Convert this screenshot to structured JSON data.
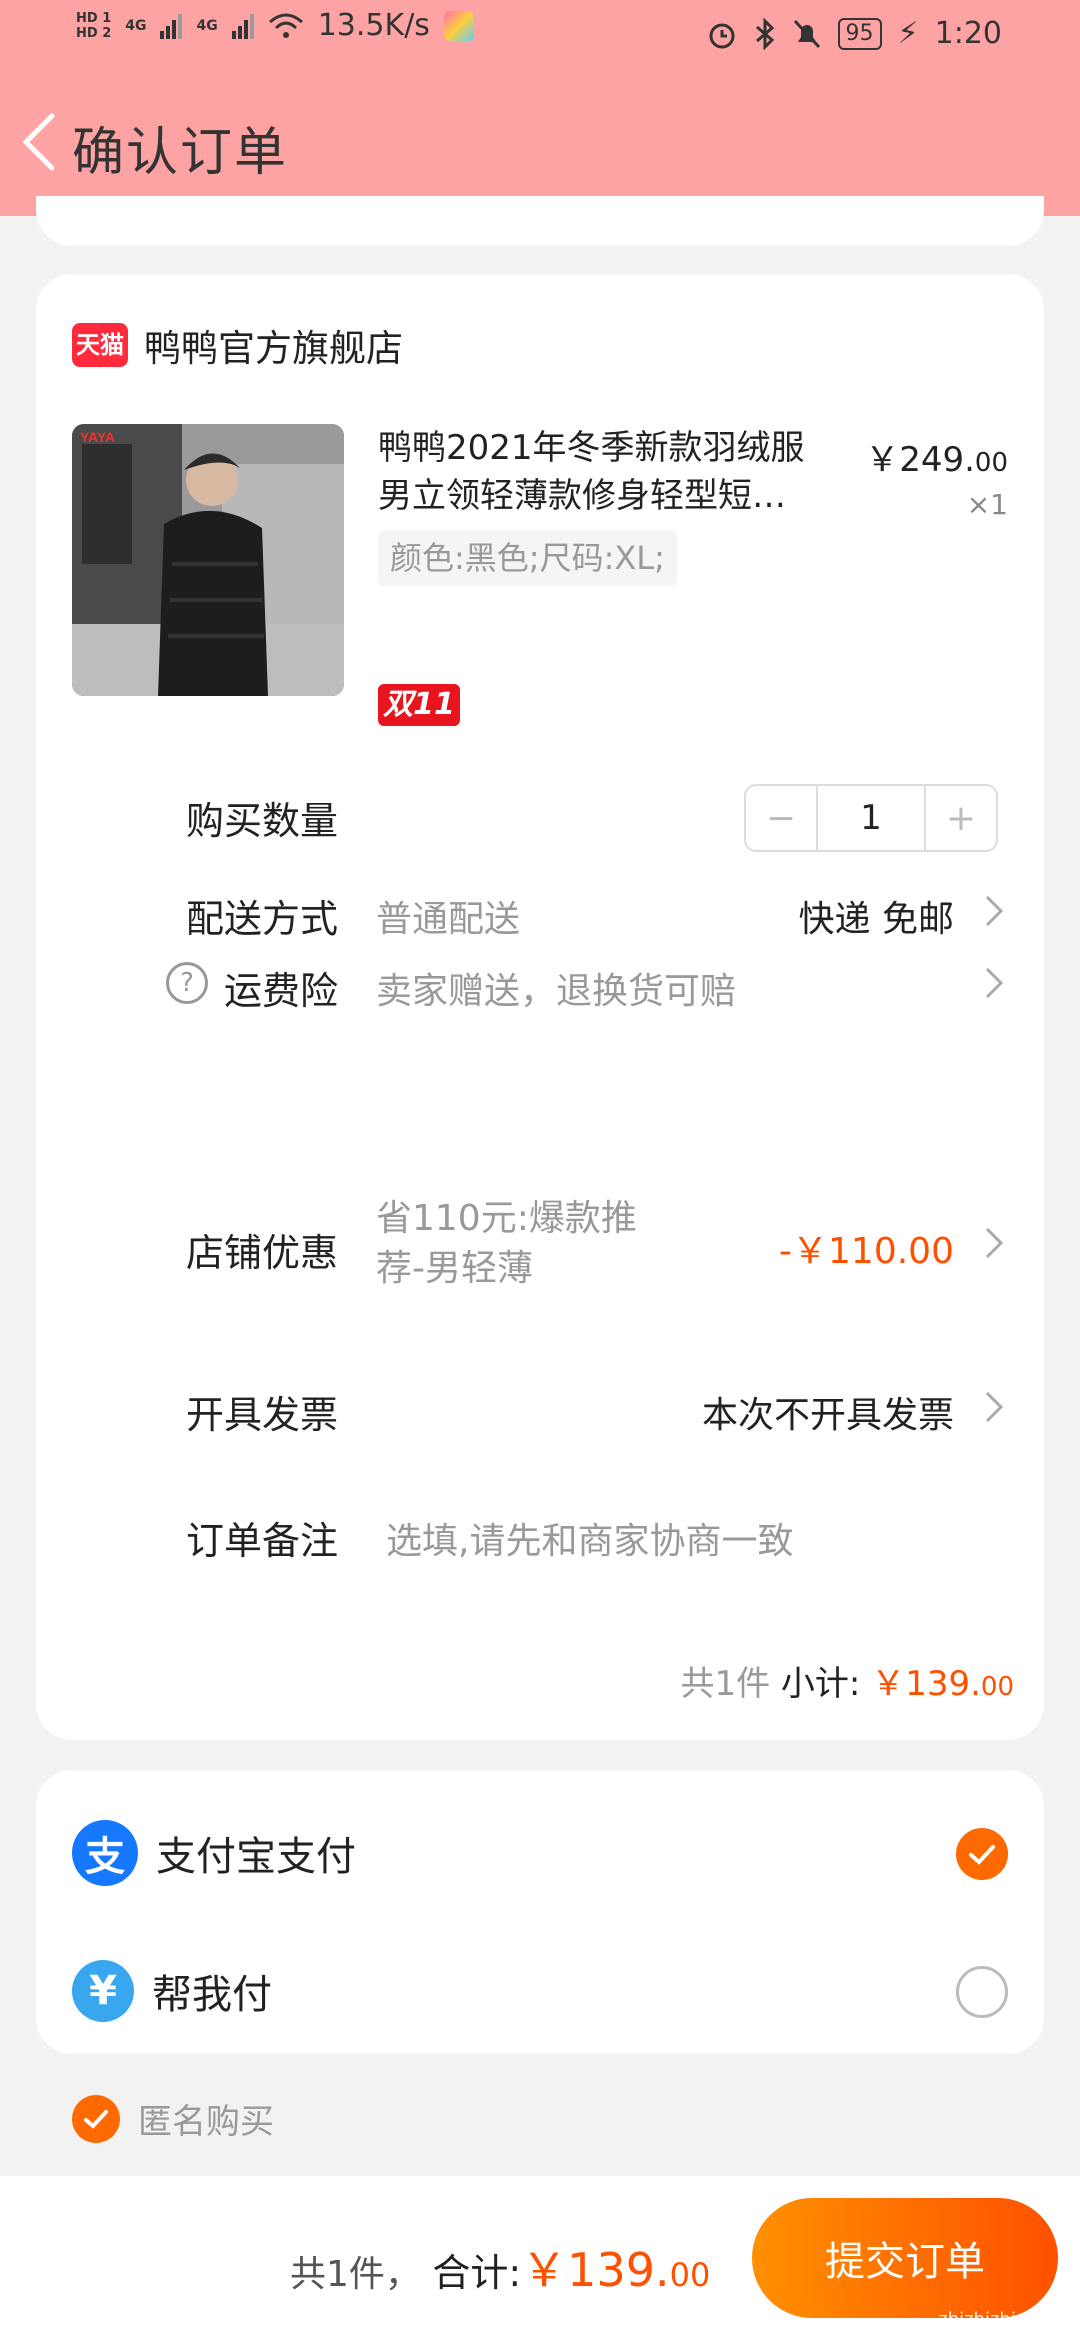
{
  "status_bar": {
    "net_speed": "13.5K/s",
    "battery": "95",
    "time": "1:20",
    "hd1": "HD 1",
    "hd2": "HD 2",
    "net1": "4G",
    "net2": "4G"
  },
  "header": {
    "title": "确认订单"
  },
  "shop": {
    "badge": "天猫",
    "name": "鸭鸭官方旗舰店"
  },
  "product": {
    "title": "鸭鸭2021年冬季新款羽绒服男立领轻薄款修身轻型短…",
    "price_main": "￥249.",
    "price_cents": "00",
    "qty": "×1",
    "sku": "颜色:黑色;尺码:XL;",
    "promo_badge": "双11"
  },
  "rows": {
    "quantity_label": "购买数量",
    "quantity_value": "1",
    "minus": "−",
    "plus": "+",
    "delivery_label": "配送方式",
    "delivery_value": "普通配送",
    "delivery_right": "快递 免邮",
    "insurance_icon": "?",
    "insurance_label": "运费险",
    "insurance_value": "卖家赠送，退换货可赔",
    "discount_label": "店铺优惠",
    "discount_value": "省110元:爆款推荐-男轻薄",
    "discount_amount": "-￥110.00",
    "invoice_label": "开具发票",
    "invoice_value": "本次不开具发票",
    "note_label": "订单备注",
    "note_placeholder": "选填,请先和商家协商一致"
  },
  "subtotal": {
    "count": "共1件",
    "label": "小计:",
    "amount_main": "￥139.",
    "amount_cents": "00"
  },
  "payment": {
    "alipay_icon": "支",
    "alipay_label": "支付宝支付",
    "alipay_selected": true,
    "help_icon": "¥",
    "help_label": "帮我付",
    "help_selected": false
  },
  "anonymous": {
    "label": "匿名购买",
    "checked": true
  },
  "footer": {
    "count": "共1件，",
    "total_label": "合计:",
    "total_main": "￥139.",
    "total_cents": "00",
    "submit": "提交订单",
    "watermark": "zhizhizhi.com"
  },
  "colors": {
    "accent": "#ff5000",
    "header_bg": "#fda3a3",
    "tmall": "#ff2b3c",
    "alipay": "#1677ff"
  }
}
